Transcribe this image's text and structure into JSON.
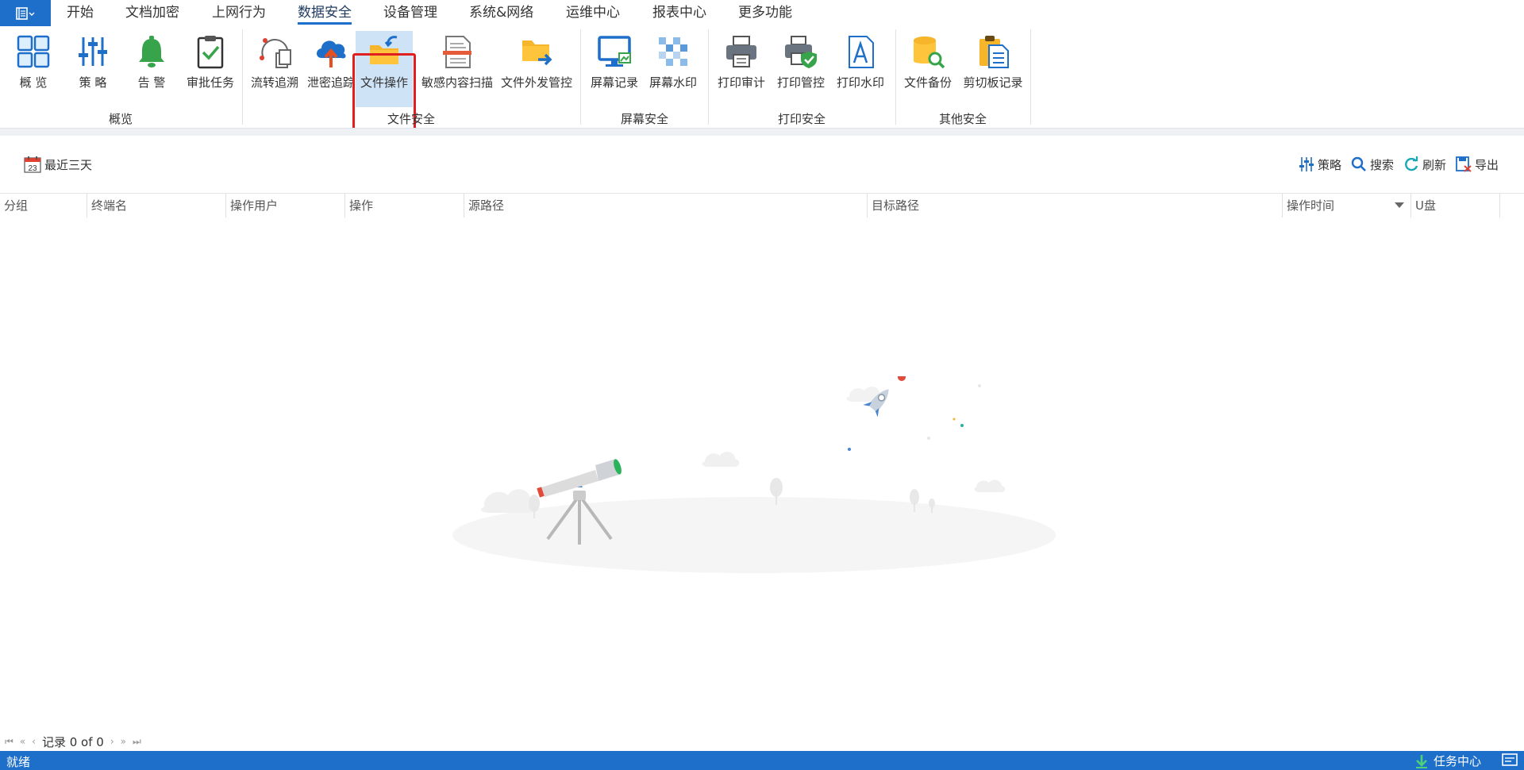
{
  "menu": {
    "tabs": [
      "开始",
      "文档加密",
      "上网行为",
      "数据安全",
      "设备管理",
      "系统&网络",
      "运维中心",
      "报表中心",
      "更多功能"
    ],
    "active": "数据安全"
  },
  "ribbon": {
    "groups": {
      "overview": "概览",
      "file_security": "文件安全",
      "screen_security": "屏幕安全",
      "print_security": "打印安全",
      "other_security": "其他安全"
    },
    "buttons": {
      "overview": "概 览",
      "policy": "策 略",
      "alarm": "告 警",
      "approval": "审批任务",
      "flow_trace": "流转追溯",
      "leak_trace": "泄密追踪",
      "file_ops": "文件操作",
      "sensitive_scan": "敏感内容扫描",
      "outgoing_control": "文件外发管控",
      "screen_record": "屏幕记录",
      "screen_watermark": "屏幕水印",
      "print_audit": "打印审计",
      "print_control": "打印管控",
      "print_watermark": "打印水印",
      "file_backup": "文件备份",
      "clipboard_record": "剪切板记录"
    }
  },
  "toolbar": {
    "date_range": "最近三天",
    "calendar_day": "23",
    "policy": "策略",
    "search": "搜索",
    "refresh": "刷新",
    "export": "导出"
  },
  "grid": {
    "columns": [
      "分组",
      "终端名",
      "操作用户",
      "操作",
      "源路径",
      "目标路径",
      "操作时间",
      "U盘"
    ]
  },
  "pager": {
    "text": "记录 0 of 0"
  },
  "status": {
    "text": "就绪",
    "task_center": "任务中心"
  },
  "colors": {
    "accent": "#1e6fc9",
    "selection_border": "#e02020",
    "selected_bg": "#cfe3f7"
  }
}
